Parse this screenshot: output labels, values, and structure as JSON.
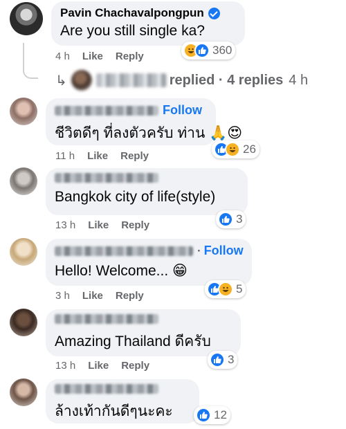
{
  "main_comment": {
    "author": "Pavin Chachavalpongpun",
    "text": "Are you still single ka?",
    "time": "4 h",
    "like_label": "Like",
    "reply_label": "Reply",
    "reactions": [
      "haha",
      "like"
    ],
    "reaction_count": "360"
  },
  "replies_summary": {
    "arrow": "↳",
    "text": "replied · 4 replies",
    "time": "4 h"
  },
  "comments": [
    {
      "follow": "Follow",
      "text": "ชีวิตดีๆ ที่ลงตัวครับ ท่าน 🙏😍",
      "time": "11 h",
      "like_label": "Like",
      "reply_label": "Reply",
      "reactions": [
        "like",
        "haha"
      ],
      "reaction_count": "26"
    },
    {
      "text": "Bangkok city of life(style)",
      "time": "13 h",
      "like_label": "Like",
      "reply_label": "Reply",
      "reactions": [
        "like"
      ],
      "reaction_count": "3"
    },
    {
      "follow": "Follow",
      "text": "Hello! Welcome... 😁",
      "time": "3 h",
      "like_label": "Like",
      "reply_label": "Reply",
      "reactions": [
        "like",
        "haha"
      ],
      "reaction_count": "5"
    },
    {
      "text": "Amazing Thailand ดีครับ",
      "time": "13 h",
      "like_label": "Like",
      "reply_label": "Reply",
      "reactions": [
        "like"
      ],
      "reaction_count": "3"
    },
    {
      "text": "ล้างเท้ากันดีๆนะคะ",
      "reactions": [
        "like"
      ],
      "reaction_count": "12"
    }
  ],
  "colors": {
    "accent": "#1877f2",
    "bubble": "#f0f2f5",
    "meta": "#65676b"
  },
  "icons": {
    "like": "thumbs-up-icon",
    "haha": "laughing-face-icon",
    "verified": "verified-badge-icon"
  }
}
